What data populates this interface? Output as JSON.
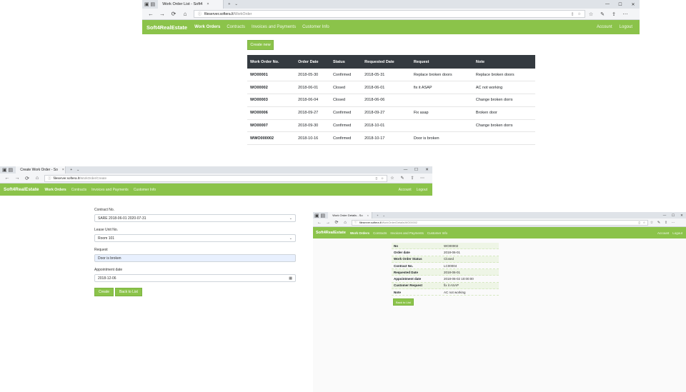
{
  "list_window": {
    "tab_title": "Work Order List - Soft4",
    "url_host": "fileserver.softera.lt",
    "url_path": "/WorkOrder",
    "brand": "Soft4RealEstate",
    "nav": [
      "Work Orders",
      "Contracts",
      "Invoices and Payments",
      "Customer Info"
    ],
    "nav_right": [
      "Account",
      "Logout"
    ],
    "create_label": "Create new",
    "columns": [
      "Work Order No.",
      "Order Date",
      "Status",
      "Requested Date",
      "Request",
      "Note"
    ],
    "rows": [
      [
        "WO00001",
        "2018-05-30",
        "Confirmed",
        "2018-05-31",
        "Replace broken doors",
        "Replace broken doors"
      ],
      [
        "WO00002",
        "2018-06-01",
        "Closed",
        "2018-06-01",
        "fix it ASAP",
        "AC not working"
      ],
      [
        "WO00003",
        "2018-06-04",
        "Closed",
        "2018-06-06",
        "",
        "Change broken dorrs"
      ],
      [
        "WO00006",
        "2018-09-27",
        "Confirmed",
        "2018-09-27",
        "Fix asap",
        "Broken door"
      ],
      [
        "WO00007",
        "2018-09-30",
        "Confirmed",
        "2018-10-01",
        "",
        "Change broken dorrs"
      ],
      [
        "WWO000002",
        "2018-10-16",
        "Confirmed",
        "2018-10-17",
        "Door is broken",
        ""
      ]
    ]
  },
  "create_window": {
    "tab_title": "Create Work Order - So",
    "url_host": "fileserver.softera.lt",
    "url_path": "/WorkOrder/Create",
    "brand": "Soft4RealEstate",
    "nav": [
      "Work Orders",
      "Contracts",
      "Invoices and Payments",
      "Customer Info"
    ],
    "nav_right": [
      "Account",
      "Logout"
    ],
    "contract_label": "Contract No.",
    "contract_value": "SARE 2018-06-01 2020-07-31",
    "lease_label": "Lease Unit No.",
    "lease_value": "Room 101",
    "request_label": "Request",
    "request_value": "Door is broken",
    "appt_label": "Appointment date",
    "appt_value": "2018-12-06",
    "create_btn": "Create",
    "back_btn": "Back to List"
  },
  "details_window": {
    "tab_title": "Work Order Details - So",
    "url_host": "fileserver.softera.lt",
    "url_path": "/WorkOrder/Details/WO00002",
    "brand": "Soft4RealEstate",
    "nav": [
      "Work Orders",
      "Contracts",
      "Invoices and Payments",
      "Customer Info"
    ],
    "nav_right": [
      "Account",
      "Logout"
    ],
    "fields": [
      {
        "label": "No",
        "value": "WO00002"
      },
      {
        "label": "Order date",
        "value": "2018-06-01"
      },
      {
        "label": "Work Order Status",
        "value": "Closed"
      },
      {
        "label": "Contract No.",
        "value": "LC00004"
      },
      {
        "label": "Requested Date",
        "value": "2018-06-01"
      },
      {
        "label": "Appointment date",
        "value": "2018-06-02 10:00:00"
      },
      {
        "label": "Customer Request",
        "value": "fix it ASAP"
      },
      {
        "label": "Note",
        "value": "AC not working"
      }
    ],
    "back_btn": "Back to List"
  },
  "icons": {
    "tab_close": "×",
    "new_tab": "+",
    "minimize": "—",
    "maximize": "☐",
    "close": "✕",
    "back": "←",
    "forward": "→",
    "refresh": "⟳",
    "home": "⌂",
    "info": "ⓘ",
    "reading": "▯",
    "favorite": "☆",
    "favorites": "☆",
    "notes": "✎",
    "share": "⇪",
    "more": "⋯",
    "dropdown": "⌄",
    "calendar": "▦"
  }
}
